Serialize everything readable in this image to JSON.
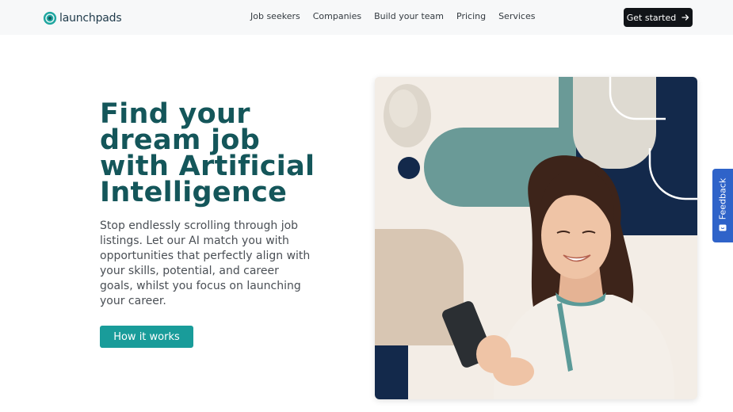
{
  "header": {
    "logo_text": "launchpads",
    "nav": [
      {
        "label": "Job seekers"
      },
      {
        "label": "Companies"
      },
      {
        "label": "Build your team"
      },
      {
        "label": "Pricing"
      },
      {
        "label": "Services"
      }
    ],
    "cta_label": "Get started"
  },
  "hero": {
    "title_lines": [
      "Find your",
      "dream job",
      "with Artificial",
      "Intelligence"
    ],
    "description_lines": [
      "Stop endlessly scrolling through job",
      "listings. Let our AI match you with",
      "opportunities that perfectly align with",
      "your skills, potential, and career",
      "goals, whilst you focus on launching",
      "your career."
    ],
    "button_label": "How it works"
  },
  "feedback_tab": {
    "label": "Feedback"
  },
  "colors": {
    "brand_teal": "#14565a",
    "button_teal": "#199c9a",
    "navy": "#13294b",
    "sage": "#6a9a97",
    "beige": "#d8c6b3",
    "feedback_blue": "#2f63c9"
  },
  "icons": {
    "logo": "launchpads-logo-icon",
    "cta_arrow": "arrow-right-icon",
    "feedback": "chat-icon"
  }
}
